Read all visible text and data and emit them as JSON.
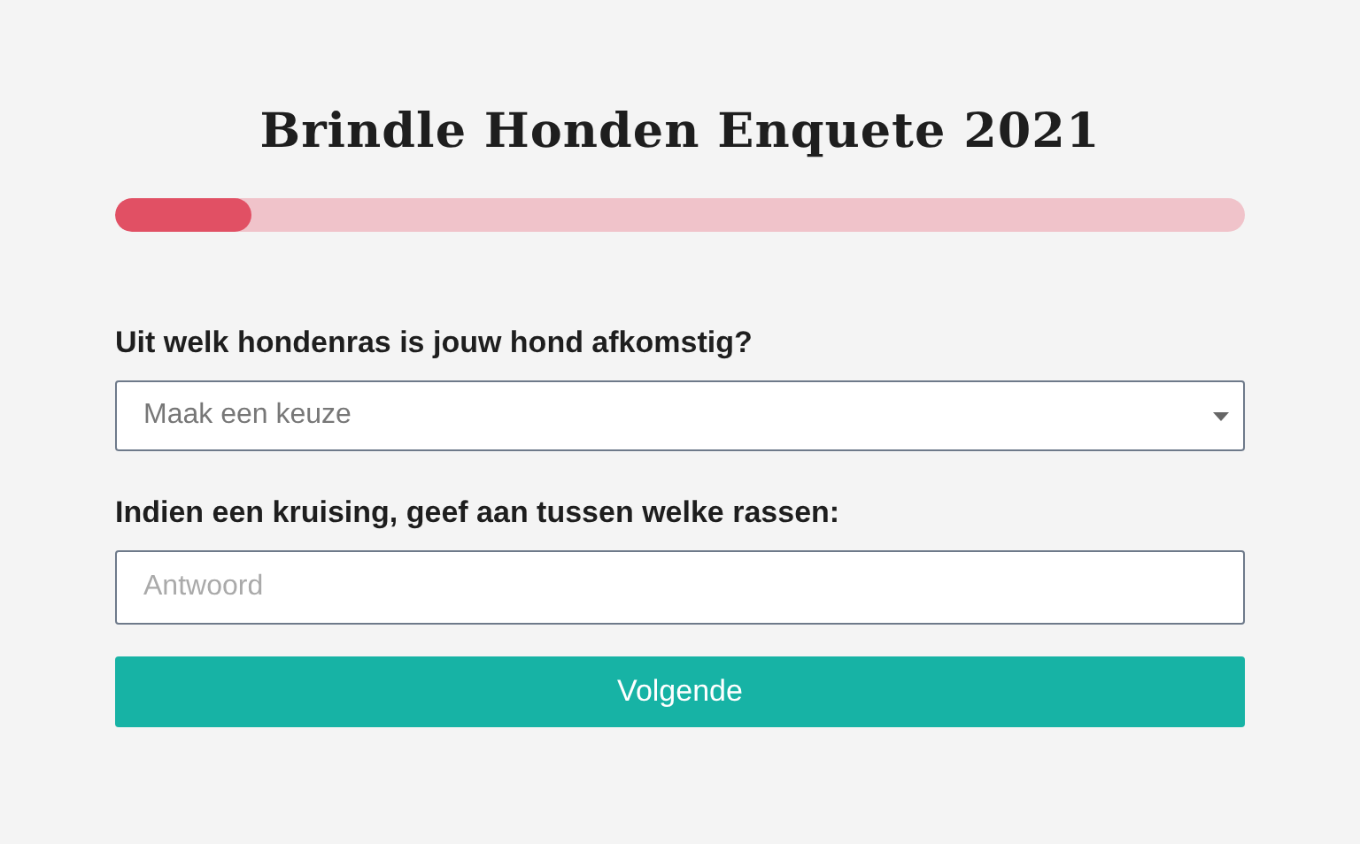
{
  "title": "Brindle Honden Enquete 2021",
  "progress": {
    "level": 0.12
  },
  "questions": [
    {
      "kind": "select",
      "label": "Uit welk hondenras is jouw hond afkomstig?",
      "placeholder": "Maak een keuze"
    },
    {
      "kind": "text",
      "label": "Indien een kruising, geef aan tussen welke rassen:",
      "placeholder": "Antwoord"
    }
  ],
  "button": "Volgende"
}
